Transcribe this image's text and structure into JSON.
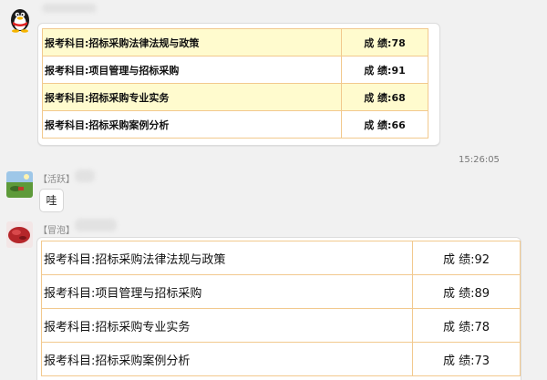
{
  "messages": [
    {
      "sender_tag": "",
      "rows": [
        {
          "subject": "报考科目:招标采购法律法规与政策",
          "score": "成 绩:78",
          "highlight": true
        },
        {
          "subject": "报考科目:项目管理与招标采购",
          "score": "成 绩:91",
          "highlight": false
        },
        {
          "subject": "报考科目:招标采购专业实务",
          "score": "成 绩:68",
          "highlight": true
        },
        {
          "subject": "报考科目:招标采购案例分析",
          "score": "成 绩:66",
          "highlight": false
        }
      ]
    },
    {
      "timestamp": "15:26:05"
    },
    {
      "sender_tag": "【活跃】",
      "text": "哇"
    },
    {
      "sender_tag": "【冒泡】",
      "rows": [
        {
          "subject": "报考科目:招标采购法律法规与政策",
          "score": "成 绩:92"
        },
        {
          "subject": "报考科目:项目管理与招标采购",
          "score": "成 绩:89"
        },
        {
          "subject": "报考科目:招标采购专业实务",
          "score": "成 绩:78"
        },
        {
          "subject": "报考科目:招标采购案例分析",
          "score": "成 绩:73"
        }
      ]
    }
  ],
  "colors": {
    "highlight_row": "#fffbce",
    "table_border": "#f2c98e",
    "background": "#f1f1f1"
  },
  "icons": {
    "avatar_1": "qq-penguin-icon",
    "avatar_2": "landscape-avatar",
    "avatar_3": "red-food-avatar"
  }
}
